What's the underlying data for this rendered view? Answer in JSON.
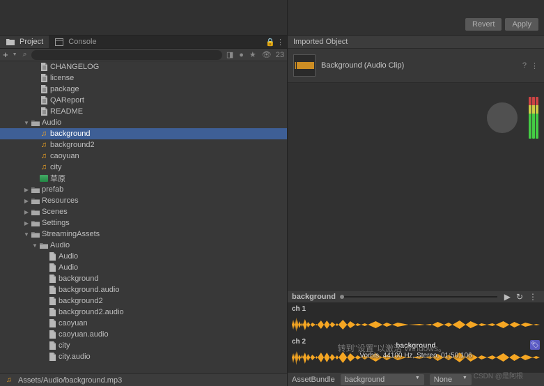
{
  "topButtons": {
    "revert": "Revert",
    "apply": "Apply"
  },
  "tabs": {
    "project": "Project",
    "console": "Console"
  },
  "toolbar": {
    "searchPlaceholder": "",
    "hiddenCount": "23",
    "eyeIcon": "👁"
  },
  "tree": [
    {
      "indent": 2,
      "type": "doc",
      "label": "CHANGELOG",
      "arrow": ""
    },
    {
      "indent": 2,
      "type": "doc",
      "label": "license",
      "arrow": ""
    },
    {
      "indent": 2,
      "type": "doc",
      "label": "package",
      "arrow": ""
    },
    {
      "indent": 2,
      "type": "doc",
      "label": "QAReport",
      "arrow": ""
    },
    {
      "indent": 2,
      "type": "doc",
      "label": "README",
      "arrow": ""
    },
    {
      "indent": 1,
      "type": "folder",
      "label": "Audio",
      "arrow": "▼"
    },
    {
      "indent": 2,
      "type": "audio",
      "label": "background",
      "arrow": "",
      "selected": true
    },
    {
      "indent": 2,
      "type": "audio",
      "label": "background2",
      "arrow": ""
    },
    {
      "indent": 2,
      "type": "audio",
      "label": "caoyuan",
      "arrow": ""
    },
    {
      "indent": 2,
      "type": "audio",
      "label": "city",
      "arrow": ""
    },
    {
      "indent": 2,
      "type": "img",
      "label": "草原",
      "arrow": ""
    },
    {
      "indent": 1,
      "type": "folder",
      "label": "prefab",
      "arrow": "▶"
    },
    {
      "indent": 1,
      "type": "folder",
      "label": "Resources",
      "arrow": "▶"
    },
    {
      "indent": 1,
      "type": "folder",
      "label": "Scenes",
      "arrow": "▶"
    },
    {
      "indent": 1,
      "type": "folder",
      "label": "Settings",
      "arrow": "▶"
    },
    {
      "indent": 1,
      "type": "folder",
      "label": "StreamingAssets",
      "arrow": "▼"
    },
    {
      "indent": 2,
      "type": "folder",
      "label": "Audio",
      "arrow": "▼"
    },
    {
      "indent": 3,
      "type": "file",
      "label": "Audio",
      "arrow": ""
    },
    {
      "indent": 3,
      "type": "file",
      "label": "Audio",
      "arrow": ""
    },
    {
      "indent": 3,
      "type": "file",
      "label": "background",
      "arrow": ""
    },
    {
      "indent": 3,
      "type": "file",
      "label": "background.audio",
      "arrow": ""
    },
    {
      "indent": 3,
      "type": "file",
      "label": "background2",
      "arrow": ""
    },
    {
      "indent": 3,
      "type": "file",
      "label": "background2.audio",
      "arrow": ""
    },
    {
      "indent": 3,
      "type": "file",
      "label": "caoyuan",
      "arrow": ""
    },
    {
      "indent": 3,
      "type": "file",
      "label": "caoyuan.audio",
      "arrow": ""
    },
    {
      "indent": 3,
      "type": "file",
      "label": "city",
      "arrow": ""
    },
    {
      "indent": 3,
      "type": "file",
      "label": "city.audio",
      "arrow": ""
    }
  ],
  "pathBar": {
    "path": "Assets/Audio/background.mp3"
  },
  "inspector": {
    "header": "Imported Object",
    "objectName": "Background (Audio Clip)",
    "previewName": "background",
    "ch1": "ch 1",
    "ch2": "ch 2",
    "waveLabel": "background",
    "formatInfo": "Vorbis, 44100 Hz, Stereo, 01:50.106",
    "activate1": "激活 Windows",
    "activate2": "转到\"设置\"以激活 Windows。",
    "bundleLabel": "AssetBundle",
    "bundleValue": "background",
    "bundleNone": "None"
  },
  "watermark": "CSDN @是阿根"
}
